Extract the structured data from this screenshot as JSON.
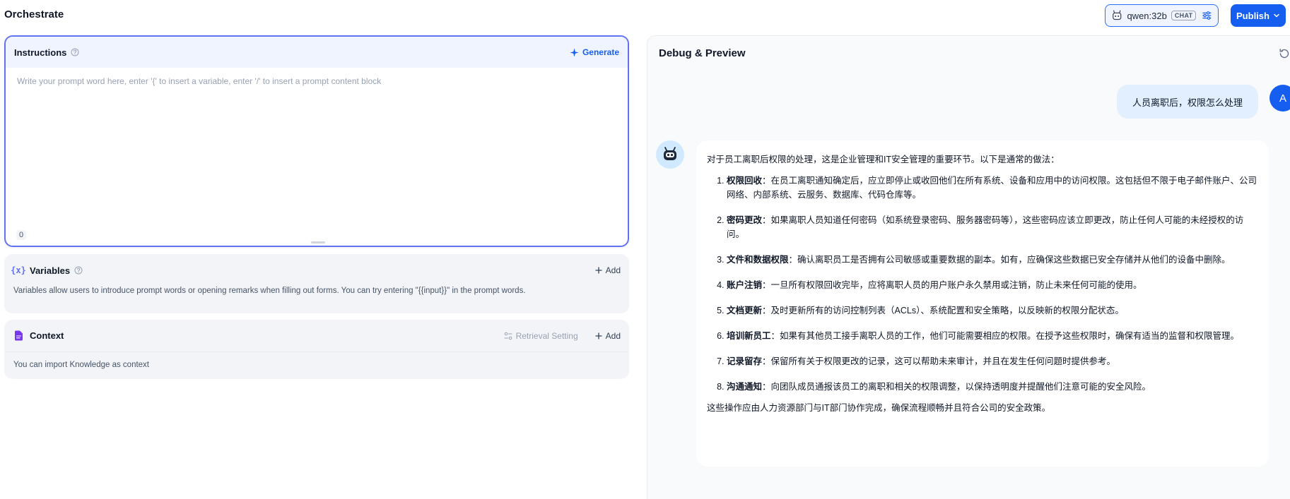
{
  "header": {
    "title": "Orchestrate",
    "model_name": "qwen:32b",
    "model_badge": "CHAT",
    "publish_label": "Publish",
    "model_icon": "robot-icon",
    "settings_icon": "sliders-icon"
  },
  "instructions": {
    "title": "Instructions",
    "generate_label": "Generate",
    "placeholder": "Write your prompt word here, enter '{' to insert a variable, enter '/' to insert a prompt content block",
    "value": "",
    "char_count": "0"
  },
  "variables": {
    "title": "Variables",
    "add_label": "Add",
    "description": "Variables allow users to introduce prompt words or opening remarks when filling out forms. You can try entering \"{{input}}\" in the prompt words."
  },
  "context": {
    "title": "Context",
    "retrieval_label": "Retrieval Setting",
    "add_label": "Add",
    "description": "You can import Knowledge as context"
  },
  "debug": {
    "title": "Debug & Preview",
    "user_avatar_letter": "A",
    "user_message": "人员离职后，权限怎么处理",
    "bot_intro": "对于员工离职后权限的处理，这是企业管理和IT安全管理的重要环节。以下是通常的做法：",
    "bot_items": [
      {
        "title": "权限回收",
        "text": "：在员工离职通知确定后，应立即停止或收回他们在所有系统、设备和应用中的访问权限。这包括但不限于电子邮件账户、公司网络、内部系统、云服务、数据库、代码仓库等。"
      },
      {
        "title": "密码更改",
        "text": "：如果离职人员知道任何密码（如系统登录密码、服务器密码等），这些密码应该立即更改，防止任何人可能的未经授权的访问。"
      },
      {
        "title": "文件和数据权限",
        "text": "：确认离职员工是否拥有公司敏感或重要数据的副本。如有，应确保这些数据已安全存储并从他们的设备中删除。"
      },
      {
        "title": "账户注销",
        "text": "：一旦所有权限回收完毕，应将离职人员的用户账户永久禁用或注销，防止未来任何可能的使用。"
      },
      {
        "title": "文档更新",
        "text": "：及时更新所有的访问控制列表（ACLs）、系统配置和安全策略，以反映新的权限分配状态。"
      },
      {
        "title": "培训新员工",
        "text": "：如果有其他员工接手离职人员的工作，他们可能需要相应的权限。在授予这些权限时，确保有适当的监督和权限管理。"
      },
      {
        "title": "记录留存",
        "text": "：保留所有关于权限更改的记录，这可以帮助未来审计，并且在发生任何问题时提供参考。"
      },
      {
        "title": "沟通通知",
        "text": "：向团队成员通报该员工的离职和相关的权限调整，以保持透明度并提醒他们注意可能的安全风险。"
      }
    ],
    "bot_outro": "这些操作应由人力资源部门与IT部门协作完成，确保流程顺畅并且符合公司的安全政策。"
  }
}
